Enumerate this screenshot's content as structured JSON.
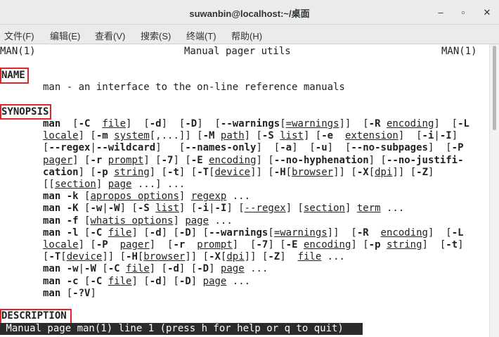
{
  "window": {
    "title": "suwanbin@localhost:~/桌面",
    "minimize_glyph": "–",
    "maximize_glyph": "▫",
    "close_glyph": "✕"
  },
  "menu": [
    "文件(F)",
    "编辑(E)",
    "查看(V)",
    "搜索(S)",
    "终端(T)",
    "帮助(H)"
  ],
  "terminal": {
    "header_left": "MAN(1)",
    "header_center": "Manual pager utils",
    "header_right": "MAN(1)",
    "name_heading": "NAME",
    "name_text": "man - an interface to the on-line reference manuals",
    "synopsis_heading": "SYNOPSIS",
    "synopsis_lines": [
      [
        [
          "man",
          "b"
        ],
        [
          "  [",
          "n"
        ],
        [
          "-C",
          "b"
        ],
        [
          "  ",
          "n"
        ],
        [
          "file",
          "u"
        ],
        [
          "]  [",
          "n"
        ],
        [
          "-d",
          "b"
        ],
        [
          "]  [",
          "n"
        ],
        [
          "-D",
          "b"
        ],
        [
          "]  [",
          "n"
        ],
        [
          "--warnings",
          "b"
        ],
        [
          "[",
          "n"
        ],
        [
          "=warnings",
          "u"
        ],
        [
          "]]  [",
          "n"
        ],
        [
          "-R",
          "b"
        ],
        [
          " ",
          "n"
        ],
        [
          "encoding",
          "u"
        ],
        [
          "]  [",
          "n"
        ],
        [
          "-L",
          "b"
        ]
      ],
      [
        [
          "locale",
          "u"
        ],
        [
          "] [",
          "n"
        ],
        [
          "-m",
          "b"
        ],
        [
          " ",
          "n"
        ],
        [
          "system",
          "u"
        ],
        [
          "[,...]] [",
          "n"
        ],
        [
          "-M",
          "b"
        ],
        [
          " ",
          "n"
        ],
        [
          "path",
          "u"
        ],
        [
          "] [",
          "n"
        ],
        [
          "-S",
          "b"
        ],
        [
          " ",
          "n"
        ],
        [
          "list",
          "u"
        ],
        [
          "] [",
          "n"
        ],
        [
          "-e",
          "b"
        ],
        [
          "  ",
          "n"
        ],
        [
          "extension",
          "u"
        ],
        [
          "]  [",
          "n"
        ],
        [
          "-i",
          "b"
        ],
        [
          "|",
          "n"
        ],
        [
          "-I",
          "b"
        ],
        [
          "]",
          "n"
        ]
      ],
      [
        [
          "[",
          "n"
        ],
        [
          "--regex",
          "b"
        ],
        [
          "|",
          "n"
        ],
        [
          "--wildcard",
          "b"
        ],
        [
          "]   [",
          "n"
        ],
        [
          "--names-only",
          "b"
        ],
        [
          "]  [",
          "n"
        ],
        [
          "-a",
          "b"
        ],
        [
          "]  [",
          "n"
        ],
        [
          "-u",
          "b"
        ],
        [
          "]  [",
          "n"
        ],
        [
          "--no-subpages",
          "b"
        ],
        [
          "]  [",
          "n"
        ],
        [
          "-P",
          "b"
        ]
      ],
      [
        [
          "pager",
          "u"
        ],
        [
          "] [",
          "n"
        ],
        [
          "-r",
          "b"
        ],
        [
          " ",
          "n"
        ],
        [
          "prompt",
          "u"
        ],
        [
          "] [",
          "n"
        ],
        [
          "-7",
          "b"
        ],
        [
          "] [",
          "n"
        ],
        [
          "-E",
          "b"
        ],
        [
          " ",
          "n"
        ],
        [
          "encoding",
          "u"
        ],
        [
          "] [",
          "n"
        ],
        [
          "--no-hyphenation",
          "b"
        ],
        [
          "] [",
          "n"
        ],
        [
          "--no-justifi-",
          "b"
        ]
      ],
      [
        [
          "cation",
          "b"
        ],
        [
          "] [",
          "n"
        ],
        [
          "-p",
          "b"
        ],
        [
          " ",
          "n"
        ],
        [
          "string",
          "u"
        ],
        [
          "] [",
          "n"
        ],
        [
          "-t",
          "b"
        ],
        [
          "] [",
          "n"
        ],
        [
          "-T",
          "b"
        ],
        [
          "[",
          "n"
        ],
        [
          "device",
          "u"
        ],
        [
          "]] [",
          "n"
        ],
        [
          "-H",
          "b"
        ],
        [
          "[",
          "n"
        ],
        [
          "browser",
          "u"
        ],
        [
          "]] [",
          "n"
        ],
        [
          "-X",
          "b"
        ],
        [
          "[",
          "n"
        ],
        [
          "dpi",
          "u"
        ],
        [
          "]] [",
          "n"
        ],
        [
          "-Z",
          "b"
        ],
        [
          "]",
          "n"
        ]
      ],
      [
        [
          "[[",
          "n"
        ],
        [
          "section",
          "u"
        ],
        [
          "] ",
          "n"
        ],
        [
          "page",
          "u"
        ],
        [
          " ...] ...",
          "n"
        ]
      ],
      [
        [
          "man",
          "b"
        ],
        [
          " ",
          "n"
        ],
        [
          "-k",
          "b"
        ],
        [
          " [",
          "n"
        ],
        [
          "apropos options",
          "u"
        ],
        [
          "] ",
          "n"
        ],
        [
          "regexp",
          "u"
        ],
        [
          " ...",
          "n"
        ]
      ],
      [
        [
          "man",
          "b"
        ],
        [
          " ",
          "n"
        ],
        [
          "-K",
          "b"
        ],
        [
          " [",
          "n"
        ],
        [
          "-w",
          "b"
        ],
        [
          "|",
          "n"
        ],
        [
          "-W",
          "b"
        ],
        [
          "] [",
          "n"
        ],
        [
          "-S",
          "b"
        ],
        [
          " ",
          "n"
        ],
        [
          "list",
          "u"
        ],
        [
          "] [",
          "n"
        ],
        [
          "-i",
          "b"
        ],
        [
          "|",
          "n"
        ],
        [
          "-I",
          "b"
        ],
        [
          "] [",
          "n"
        ],
        [
          "--regex",
          "u"
        ],
        [
          "] [",
          "n"
        ],
        [
          "section",
          "u"
        ],
        [
          "] ",
          "n"
        ],
        [
          "term",
          "u"
        ],
        [
          " ...",
          "n"
        ]
      ],
      [
        [
          "man",
          "b"
        ],
        [
          " ",
          "n"
        ],
        [
          "-f",
          "b"
        ],
        [
          " [",
          "n"
        ],
        [
          "whatis options",
          "u"
        ],
        [
          "] ",
          "n"
        ],
        [
          "page",
          "u"
        ],
        [
          " ...",
          "n"
        ]
      ],
      [
        [
          "man",
          "b"
        ],
        [
          " ",
          "n"
        ],
        [
          "-l",
          "b"
        ],
        [
          " [",
          "n"
        ],
        [
          "-C",
          "b"
        ],
        [
          " ",
          "n"
        ],
        [
          "file",
          "u"
        ],
        [
          "] [",
          "n"
        ],
        [
          "-d",
          "b"
        ],
        [
          "] [",
          "n"
        ],
        [
          "-D",
          "b"
        ],
        [
          "] [",
          "n"
        ],
        [
          "--warnings",
          "b"
        ],
        [
          "[",
          "n"
        ],
        [
          "=warnings",
          "u"
        ],
        [
          "]]  [",
          "n"
        ],
        [
          "-R",
          "b"
        ],
        [
          "  ",
          "n"
        ],
        [
          "encoding",
          "u"
        ],
        [
          "]  [",
          "n"
        ],
        [
          "-L",
          "b"
        ]
      ],
      [
        [
          "locale",
          "u"
        ],
        [
          "] [",
          "n"
        ],
        [
          "-P",
          "b"
        ],
        [
          "  ",
          "n"
        ],
        [
          "pager",
          "u"
        ],
        [
          "]  [",
          "n"
        ],
        [
          "-r",
          "b"
        ],
        [
          "  ",
          "n"
        ],
        [
          "prompt",
          "u"
        ],
        [
          "]  [",
          "n"
        ],
        [
          "-7",
          "b"
        ],
        [
          "] [",
          "n"
        ],
        [
          "-E",
          "b"
        ],
        [
          " ",
          "n"
        ],
        [
          "encoding",
          "u"
        ],
        [
          "] [",
          "n"
        ],
        [
          "-p",
          "b"
        ],
        [
          " ",
          "n"
        ],
        [
          "string",
          "u"
        ],
        [
          "]  [",
          "n"
        ],
        [
          "-t",
          "b"
        ],
        [
          "]",
          "n"
        ]
      ],
      [
        [
          "[",
          "n"
        ],
        [
          "-T",
          "b"
        ],
        [
          "[",
          "n"
        ],
        [
          "device",
          "u"
        ],
        [
          "]] [",
          "n"
        ],
        [
          "-H",
          "b"
        ],
        [
          "[",
          "n"
        ],
        [
          "browser",
          "u"
        ],
        [
          "]] [",
          "n"
        ],
        [
          "-X",
          "b"
        ],
        [
          "[",
          "n"
        ],
        [
          "dpi",
          "u"
        ],
        [
          "]] [",
          "n"
        ],
        [
          "-Z",
          "b"
        ],
        [
          "]  ",
          "n"
        ],
        [
          "file",
          "u"
        ],
        [
          " ...",
          "n"
        ]
      ],
      [
        [
          "man",
          "b"
        ],
        [
          " ",
          "n"
        ],
        [
          "-w",
          "b"
        ],
        [
          "|",
          "n"
        ],
        [
          "-W",
          "b"
        ],
        [
          " [",
          "n"
        ],
        [
          "-C",
          "b"
        ],
        [
          " ",
          "n"
        ],
        [
          "file",
          "u"
        ],
        [
          "] [",
          "n"
        ],
        [
          "-d",
          "b"
        ],
        [
          "] [",
          "n"
        ],
        [
          "-D",
          "b"
        ],
        [
          "] ",
          "n"
        ],
        [
          "page",
          "u"
        ],
        [
          " ...",
          "n"
        ]
      ],
      [
        [
          "man",
          "b"
        ],
        [
          " ",
          "n"
        ],
        [
          "-c",
          "b"
        ],
        [
          " [",
          "n"
        ],
        [
          "-C",
          "b"
        ],
        [
          " ",
          "n"
        ],
        [
          "file",
          "u"
        ],
        [
          "] [",
          "n"
        ],
        [
          "-d",
          "b"
        ],
        [
          "] [",
          "n"
        ],
        [
          "-D",
          "b"
        ],
        [
          "] ",
          "n"
        ],
        [
          "page",
          "u"
        ],
        [
          " ...",
          "n"
        ]
      ],
      [
        [
          "man",
          "b"
        ],
        [
          " [",
          "n"
        ],
        [
          "-?V",
          "b"
        ],
        [
          "]",
          "n"
        ]
      ]
    ],
    "description_heading": "DESCRIPTION",
    "status_line": " Manual page man(1) line 1 (press h for help or q to quit)"
  },
  "colors": {
    "highlight_box": "#e0262a",
    "status_bg": "#2b2b2b",
    "titlebar_bg": "#ebebeb"
  }
}
